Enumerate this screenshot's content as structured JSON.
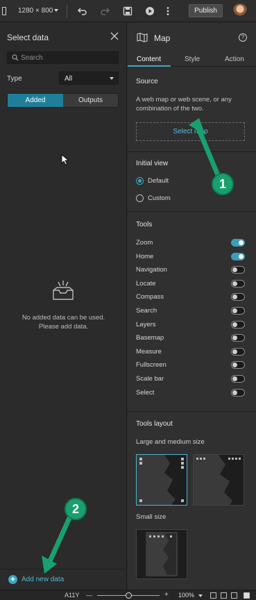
{
  "toolbar": {
    "resolution": "1280 × 800",
    "publish_label": "Publish",
    "icons": [
      "device-icon",
      "undo-icon",
      "redo-icon",
      "save-icon",
      "play-icon",
      "more-icon"
    ]
  },
  "left_panel": {
    "title": "Select data",
    "search_placeholder": "Search",
    "type_label": "Type",
    "type_value": "All",
    "tabs": [
      "Added",
      "Outputs"
    ],
    "active_tab": "Added",
    "empty_line1": "No added data can be used.",
    "empty_line2": "Please add data.",
    "add_data_label": "Add new data"
  },
  "right_panel": {
    "title": "Map",
    "tabs": [
      "Content",
      "Style",
      "Action"
    ],
    "active_tab": "Content",
    "source": {
      "title": "Source",
      "description": "A web map or web scene, or any combination of the two.",
      "select_map_label": "Select map"
    },
    "initial_view": {
      "title": "Initial view",
      "options": [
        {
          "label": "Default",
          "selected": true
        },
        {
          "label": "Custom",
          "selected": false
        }
      ]
    },
    "tools": {
      "title": "Tools",
      "items": [
        {
          "label": "Zoom",
          "on": true
        },
        {
          "label": "Home",
          "on": true
        },
        {
          "label": "Navigation",
          "on": false
        },
        {
          "label": "Locate",
          "on": false
        },
        {
          "label": "Compass",
          "on": false
        },
        {
          "label": "Search",
          "on": false
        },
        {
          "label": "Layers",
          "on": false
        },
        {
          "label": "Basemap",
          "on": false
        },
        {
          "label": "Measure",
          "on": false
        },
        {
          "label": "Fullscreen",
          "on": false
        },
        {
          "label": "Scale bar",
          "on": false
        },
        {
          "label": "Select",
          "on": false
        }
      ]
    },
    "tools_layout": {
      "title": "Tools layout",
      "large_label": "Large and medium size",
      "small_label": "Small size"
    }
  },
  "statusbar": {
    "ally": "A11Y",
    "zoom": "100%"
  },
  "annotations": {
    "marker1": "1",
    "marker2": "2",
    "color": "#18a06e"
  },
  "colors": {
    "accent": "#3ea9c6",
    "link": "#58bfdb",
    "panel_bg": "#2b2b2b",
    "active_segment": "#1f7f9a"
  }
}
